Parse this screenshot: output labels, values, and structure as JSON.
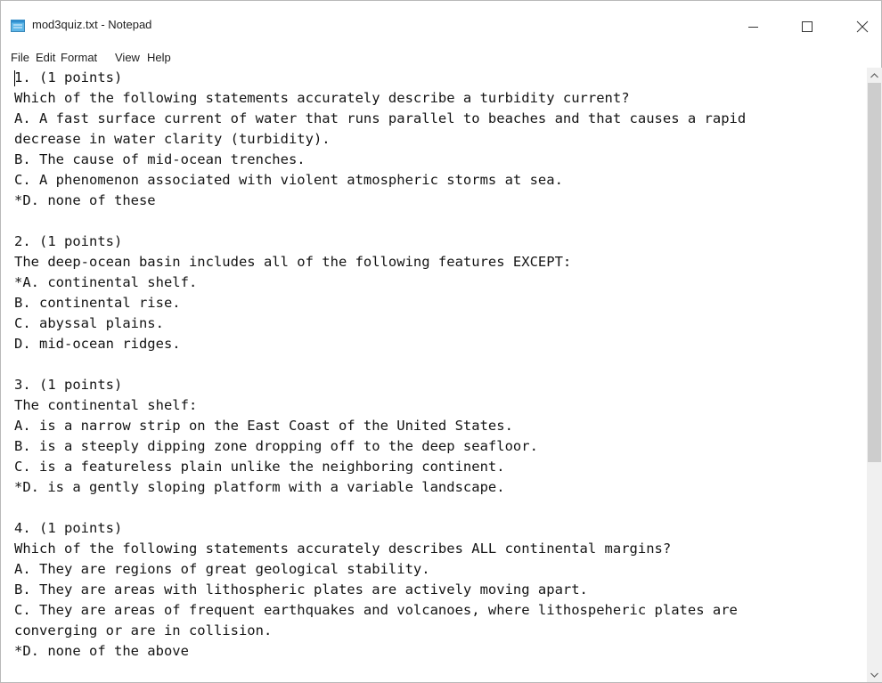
{
  "window": {
    "title": "mod3quiz.txt - Notepad",
    "icon": "notepad-icon",
    "controls": [
      "minimize-icon",
      "maximize-icon",
      "close-icon"
    ]
  },
  "menu": {
    "file": "File",
    "edit": "Edit",
    "format": "Format",
    "view": "View",
    "help": "Help"
  },
  "editor": {
    "lines": [
      "1. (1 points)",
      "Which of the following statements accurately describe a turbidity current?",
      "A. A fast surface current of water that runs parallel to beaches and that causes a rapid",
      "decrease in water clarity (turbidity).",
      "B. The cause of mid-ocean trenches.",
      "C. A phenomenon associated with violent atmospheric storms at sea.",
      "*D. none of these",
      "",
      "2. (1 points)",
      "The deep-ocean basin includes all of the following features EXCEPT:",
      "*A. continental shelf.",
      "B. continental rise.",
      "C. abyssal plains.",
      "D. mid-ocean ridges.",
      "",
      "3. (1 points)",
      "The continental shelf:",
      "A. is a narrow strip on the East Coast of the United States.",
      "B. is a steeply dipping zone dropping off to the deep seafloor.",
      "C. is a featureless plain unlike the neighboring continent.",
      "*D. is a gently sloping platform with a variable landscape.",
      "",
      "4. (1 points)",
      "Which of the following statements accurately describes ALL continental margins?",
      "A. They are regions of great geological stability.",
      "B. They are areas with lithospheric plates are actively moving apart.",
      "C. They are areas of frequent earthquakes and volcanoes, where lithospeheric plates are",
      "converging or are in collision.",
      "*D. none of the above"
    ]
  },
  "scrollbar": {
    "up_icon": "chevron-up-icon",
    "down_icon": "chevron-down-icon",
    "thumb_fraction": 0.65
  }
}
